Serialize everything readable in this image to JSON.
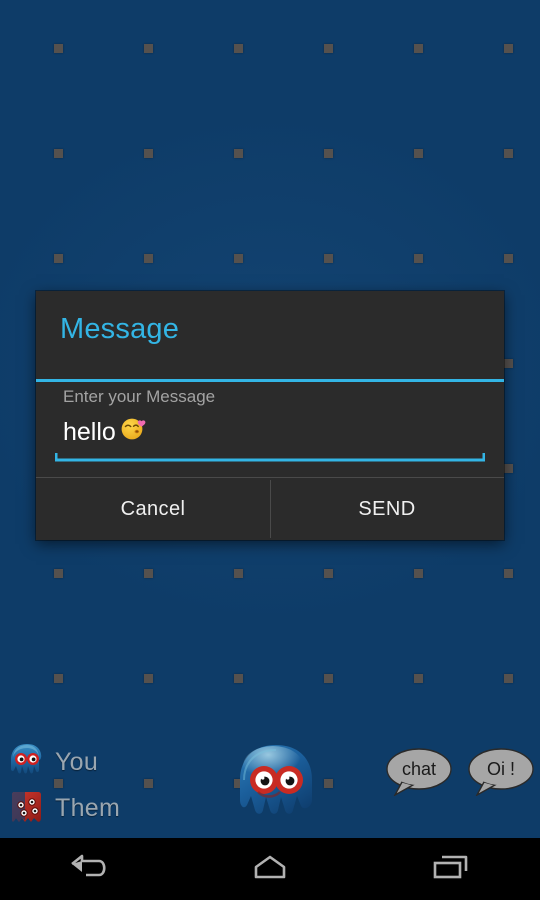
{
  "theme": {
    "wallpaper_color": "#0e3c68",
    "dot_color": "#55514e",
    "dialog_bg": "#2b2b2b",
    "accent_color": "#33b5e5",
    "label_color": "#a3a3a3",
    "button_text_color": "#f0f0f0",
    "legend_text_color": "#9aa6b0",
    "navbar_bg": "#000000",
    "nav_icon_color": "#b2b2b2"
  },
  "dialog": {
    "title": "Message",
    "field_label": "Enter your Message",
    "input_value": "hello",
    "input_emoji": "😘",
    "input_placeholder": "Enter your Message",
    "buttons": [
      {
        "label": "Cancel",
        "name": "cancel-button"
      },
      {
        "label": "SEND",
        "name": "send-button"
      }
    ]
  },
  "legend": {
    "items": [
      {
        "label": "You",
        "icon": "blue-octopus-icon"
      },
      {
        "label": "Them",
        "icon": "red-monster-icon"
      }
    ]
  },
  "mascots": {
    "center_character": "blue-octopus-character",
    "bubbles": [
      {
        "text": "chat",
        "name": "speech-bubble-chat"
      },
      {
        "text": "Oi !",
        "name": "speech-bubble-oi"
      }
    ]
  },
  "navbar": {
    "buttons": [
      {
        "name": "nav-back-button",
        "icon": "back-arrow-icon"
      },
      {
        "name": "nav-home-button",
        "icon": "home-icon"
      },
      {
        "name": "nav-recents-button",
        "icon": "recents-icon"
      }
    ]
  }
}
